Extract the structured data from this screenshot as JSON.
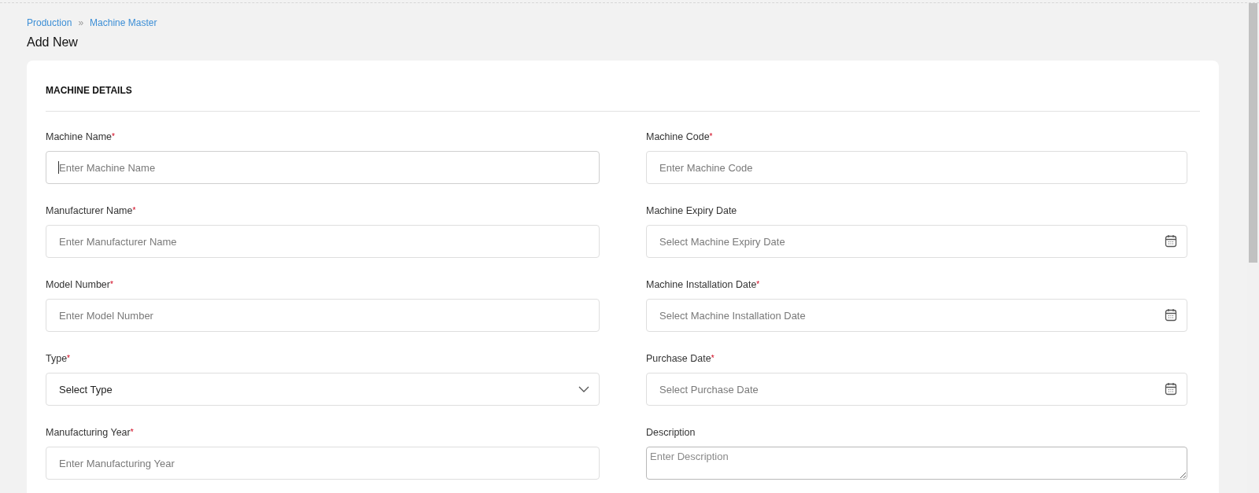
{
  "breadcrumb": {
    "items": [
      "Production",
      "Machine Master"
    ],
    "separator": "»"
  },
  "page_title": "Add New",
  "section": {
    "title": "MACHINE DETAILS",
    "fields": [
      {
        "kind": "text",
        "label": "Machine Name",
        "mark": "*",
        "placeholder": "Enter Machine Name",
        "focused": true
      },
      {
        "kind": "text",
        "label": "Machine Code",
        "mark": "*",
        "placeholder": "Enter Machine Code",
        "focused": false
      },
      {
        "kind": "text",
        "label": "Manufacturer Name",
        "mark": "*",
        "placeholder": "Enter Manufacturer Name",
        "focused": false
      },
      {
        "kind": "date",
        "label": "Machine Expiry Date",
        "placeholder": "Select Machine Expiry Date",
        "focused": false
      },
      {
        "kind": "text",
        "label": "Model Number",
        "mark": "*",
        "placeholder": "Enter Model Number",
        "focused": false
      },
      {
        "kind": "date",
        "label": "Machine Installation Date",
        "mark": "*",
        "placeholder": "Select Machine Installation Date",
        "focused": false
      },
      {
        "kind": "select",
        "label": "Type",
        "mark": "*",
        "value": "Select Type",
        "focused": false
      },
      {
        "kind": "date",
        "label": "Purchase Date",
        "mark": "*",
        "placeholder": "Select Purchase Date",
        "focused": false
      },
      {
        "kind": "text",
        "label": "Manufacturing Year",
        "mark": "*",
        "placeholder": "Enter Manufacturing Year",
        "focused": false
      },
      {
        "kind": "textarea",
        "label": "Description",
        "placeholder": "Enter Description",
        "focused": false
      }
    ]
  }
}
